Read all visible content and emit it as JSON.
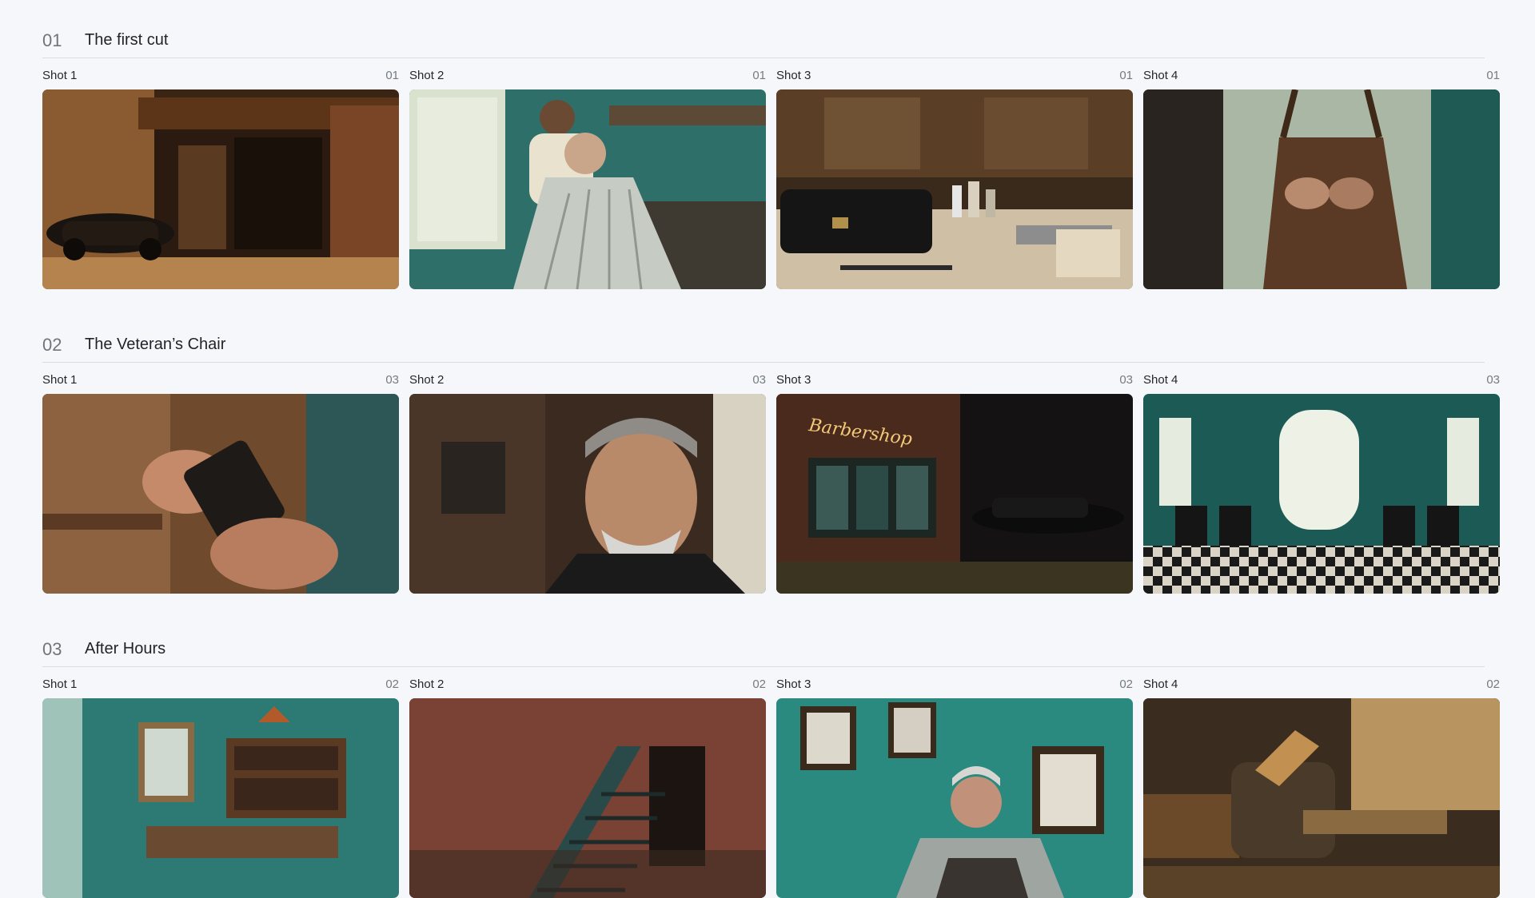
{
  "scenes": [
    {
      "number": "01",
      "title": "The first cut",
      "shots": [
        {
          "label": "Shot 1",
          "count": "01"
        },
        {
          "label": "Shot 2",
          "count": "01"
        },
        {
          "label": "Shot 3",
          "count": "01"
        },
        {
          "label": "Shot 4",
          "count": "01"
        }
      ]
    },
    {
      "number": "02",
      "title": "The Veteran’s Chair",
      "shots": [
        {
          "label": "Shot 1",
          "count": "03"
        },
        {
          "label": "Shot 2",
          "count": "03"
        },
        {
          "label": "Shot 3",
          "count": "03",
          "sign_text": "Barbershop"
        },
        {
          "label": "Shot 4",
          "count": "03"
        }
      ]
    },
    {
      "number": "03",
      "title": "After Hours",
      "shots": [
        {
          "label": "Shot 1",
          "count": "02"
        },
        {
          "label": "Shot 2",
          "count": "02"
        },
        {
          "label": "Shot 3",
          "count": "02"
        },
        {
          "label": "Shot 4",
          "count": "02"
        }
      ]
    }
  ],
  "colors": {
    "background": "#f5f7fa",
    "divider": "#d9dde3",
    "scene_number": "#6e757d",
    "shot_count": "#747b83"
  }
}
